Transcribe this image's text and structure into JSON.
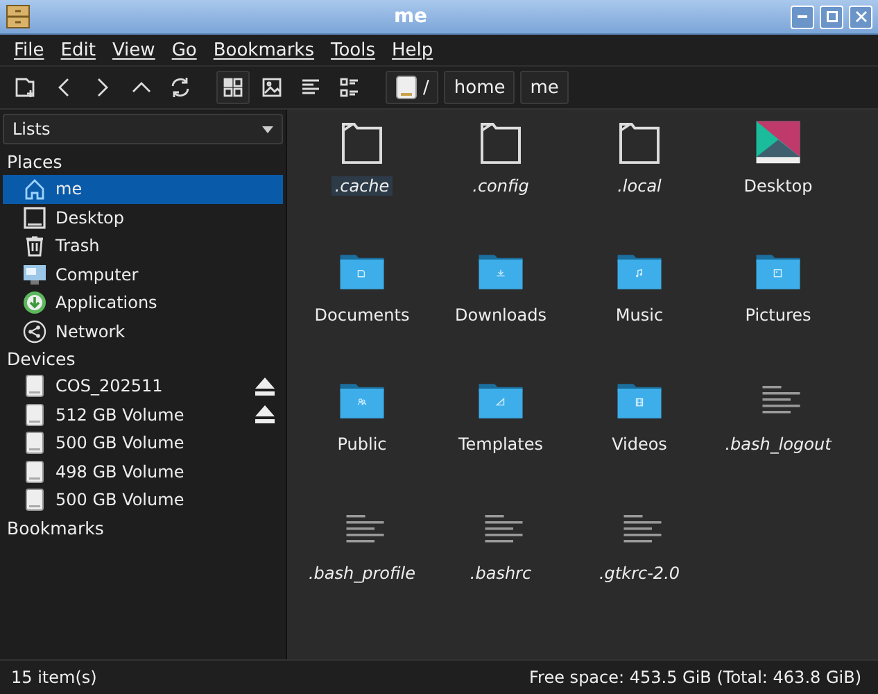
{
  "window": {
    "title": "me"
  },
  "menu": [
    "File",
    "Edit",
    "View",
    "Go",
    "Bookmarks",
    "Tools",
    "Help"
  ],
  "toolbar": {
    "nav_buttons": [
      {
        "kind": "new-window"
      },
      {
        "kind": "back"
      },
      {
        "kind": "forward"
      },
      {
        "kind": "up"
      },
      {
        "kind": "reload"
      }
    ],
    "view_buttons": [
      {
        "kind": "icons",
        "selected": true
      },
      {
        "kind": "thumbnails",
        "selected": false
      },
      {
        "kind": "compact",
        "selected": false
      },
      {
        "kind": "details",
        "selected": false
      }
    ],
    "path": [
      "/",
      "home",
      "me"
    ]
  },
  "sidebar": {
    "dropdown": "Lists",
    "sections": [
      {
        "title": "Places",
        "items": [
          {
            "label": "me",
            "kind": "home",
            "selected": true,
            "eject": false
          },
          {
            "label": "Desktop",
            "kind": "desktop",
            "selected": false,
            "eject": false
          },
          {
            "label": "Trash",
            "kind": "trash",
            "selected": false,
            "eject": false
          },
          {
            "label": "Computer",
            "kind": "computer",
            "selected": false,
            "eject": false
          },
          {
            "label": "Applications",
            "kind": "applications",
            "selected": false,
            "eject": false
          },
          {
            "label": "Network",
            "kind": "network",
            "selected": false,
            "eject": false
          }
        ]
      },
      {
        "title": "Devices",
        "items": [
          {
            "label": "COS_202511",
            "kind": "drive",
            "selected": false,
            "eject": true
          },
          {
            "label": "512 GB Volume",
            "kind": "drive",
            "selected": false,
            "eject": true
          },
          {
            "label": "500 GB Volume",
            "kind": "drive",
            "selected": false,
            "eject": false
          },
          {
            "label": "498 GB Volume",
            "kind": "drive",
            "selected": false,
            "eject": false
          },
          {
            "label": "500 GB Volume",
            "kind": "drive",
            "selected": false,
            "eject": false
          }
        ]
      },
      {
        "title": "Bookmarks"
      }
    ]
  },
  "files": [
    {
      "name": ".cache",
      "kind": "plain-folder",
      "hidden": true,
      "selected": true
    },
    {
      "name": ".config",
      "kind": "plain-folder",
      "hidden": true,
      "selected": false
    },
    {
      "name": ".local",
      "kind": "plain-folder",
      "hidden": true,
      "selected": false
    },
    {
      "name": "Desktop",
      "kind": "desktop",
      "hidden": false,
      "selected": false
    },
    {
      "name": "Documents",
      "kind": "documents",
      "hidden": false,
      "selected": false
    },
    {
      "name": "Downloads",
      "kind": "downloads",
      "hidden": false,
      "selected": false
    },
    {
      "name": "Music",
      "kind": "music",
      "hidden": false,
      "selected": false
    },
    {
      "name": "Pictures",
      "kind": "pictures",
      "hidden": false,
      "selected": false
    },
    {
      "name": "Public",
      "kind": "public",
      "hidden": false,
      "selected": false
    },
    {
      "name": "Templates",
      "kind": "templates",
      "hidden": false,
      "selected": false
    },
    {
      "name": "Videos",
      "kind": "videos",
      "hidden": false,
      "selected": false
    },
    {
      "name": ".bash_logout",
      "kind": "text",
      "hidden": true,
      "selected": false
    },
    {
      "name": ".bash_profile",
      "kind": "text",
      "hidden": true,
      "selected": false
    },
    {
      "name": ".bashrc",
      "kind": "text",
      "hidden": true,
      "selected": false
    },
    {
      "name": ".gtkrc-2.0",
      "kind": "text",
      "hidden": true,
      "selected": false
    }
  ],
  "status_bar": {
    "items": "15 item(s)",
    "free_space": "Free space: 453.5 GiB (Total: 463.8 GiB)"
  }
}
